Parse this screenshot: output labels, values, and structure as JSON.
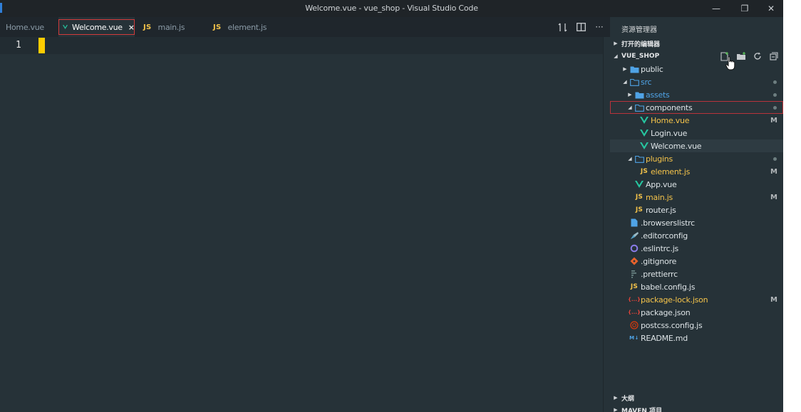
{
  "window": {
    "title": "Welcome.vue - vue_shop - Visual Studio Code",
    "controls": {
      "minimize": "—",
      "restore": "❐",
      "close": "✕"
    }
  },
  "tabs": [
    {
      "label": "Home.vue",
      "icon": "vue-icon",
      "active": false
    },
    {
      "label": "Welcome.vue",
      "icon": "vue-icon",
      "active": true,
      "close": "×"
    },
    {
      "label": "main.js",
      "icon": "js-icon",
      "icon_text": "JS",
      "active": false
    },
    {
      "label": "element.js",
      "icon": "js-icon",
      "icon_text": "JS",
      "active": false
    }
  ],
  "editor_actions": {
    "more": "···"
  },
  "editor": {
    "line_number": "1"
  },
  "sidebar": {
    "header": "资源管理器",
    "open_editors": "打开的编辑器",
    "project": "VUE_SHOP",
    "tree": [
      {
        "name": "public",
        "icon": "folder-icon",
        "twisty": "▶",
        "depth": 0,
        "color": "#dde3e6"
      },
      {
        "name": "src",
        "icon": "folder-open-icon",
        "twisty": "◢",
        "depth": 0,
        "color": "#4fa3e6",
        "dot": true
      },
      {
        "name": "assets",
        "icon": "folder-icon",
        "twisty": "▶",
        "depth": 1,
        "color": "#4fa3e6",
        "dot": true
      },
      {
        "name": "components",
        "icon": "folder-open-icon",
        "twisty": "◢",
        "depth": 1,
        "color": "#dde3e6",
        "dot": true,
        "outlined": true
      },
      {
        "name": "Home.vue",
        "icon": "vue-icon",
        "depth": 2,
        "color": "#f4c34a",
        "badge": "M"
      },
      {
        "name": "Login.vue",
        "icon": "vue-icon",
        "depth": 2,
        "color": "#dde3e6"
      },
      {
        "name": "Welcome.vue",
        "icon": "vue-icon",
        "depth": 2,
        "color": "#dde3e6",
        "selected": true
      },
      {
        "name": "plugins",
        "icon": "folder-open-icon",
        "twisty": "◢",
        "depth": 1,
        "color": "#f4c34a",
        "dot": true
      },
      {
        "name": "element.js",
        "icon": "js-icon",
        "icon_text": "JS",
        "depth": 2,
        "color": "#f4c34a",
        "badge": "M"
      },
      {
        "name": "App.vue",
        "icon": "vue-icon",
        "depth": 1,
        "color": "#dde3e6"
      },
      {
        "name": "main.js",
        "icon": "js-icon",
        "icon_text": "JS",
        "depth": 1,
        "color": "#f4c34a",
        "badge": "M"
      },
      {
        "name": "router.js",
        "icon": "js-icon",
        "icon_text": "JS",
        "depth": 1,
        "color": "#dde3e6"
      },
      {
        "name": ".browserslistrc",
        "icon": "file-icon",
        "depth": 0,
        "color": "#dde3e6"
      },
      {
        "name": ".editorconfig",
        "icon": "editorconfig-icon",
        "depth": 0,
        "color": "#dde3e6"
      },
      {
        "name": ".eslintrc.js",
        "icon": "eslint-icon",
        "depth": 0,
        "color": "#dde3e6"
      },
      {
        "name": ".gitignore",
        "icon": "git-icon",
        "depth": 0,
        "color": "#dde3e6"
      },
      {
        "name": ".prettierrc",
        "icon": "prettier-icon",
        "depth": 0,
        "color": "#dde3e6"
      },
      {
        "name": "babel.config.js",
        "icon": "js-icon",
        "icon_text": "JS",
        "depth": 0,
        "color": "#dde3e6"
      },
      {
        "name": "package-lock.json",
        "icon": "json-icon",
        "icon_text": "{...}",
        "depth": 0,
        "color": "#f4c34a",
        "badge": "M"
      },
      {
        "name": "package.json",
        "icon": "json-icon",
        "icon_text": "{...}",
        "depth": 0,
        "color": "#dde3e6"
      },
      {
        "name": "postcss.config.js",
        "icon": "postcss-icon",
        "depth": 0,
        "color": "#dde3e6"
      },
      {
        "name": "README.md",
        "icon": "markdown-icon",
        "icon_text": "M↓",
        "depth": 0,
        "color": "#dde3e6"
      }
    ],
    "outline": "大纲",
    "maven": "MAVEN 项目"
  }
}
